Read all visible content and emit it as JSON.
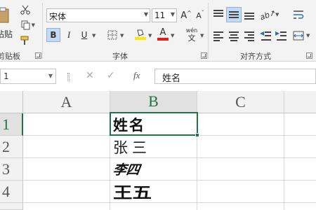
{
  "ribbon": {
    "clipboard": {
      "paste_label": "粘贴",
      "group_label": "剪贴板"
    },
    "font": {
      "font_name": "宋体",
      "font_size": "11",
      "grow_label": "A",
      "shrink_label": "A",
      "bold_label": "B",
      "italic_label": "I",
      "underline_label": "U",
      "font_color_label": "A",
      "phonetic_label": "wén",
      "group_label": "字体",
      "font_color": "#e02020",
      "highlight_color": "#ffe800"
    },
    "alignment": {
      "group_label": "对齐方式"
    }
  },
  "formula_bar": {
    "name_box": "1",
    "cancel_symbol": "✕",
    "enter_symbol": "✓",
    "fx_label": "fx",
    "content": "姓名"
  },
  "grid": {
    "columns": [
      "A",
      "B",
      "C"
    ],
    "rows": [
      "1",
      "2",
      "3",
      "4"
    ],
    "cells": {
      "B1": "姓名",
      "B2": "张三",
      "B3": "李四",
      "B4": "王五"
    },
    "selected_cell": "B1",
    "accent_color": "#217346"
  }
}
